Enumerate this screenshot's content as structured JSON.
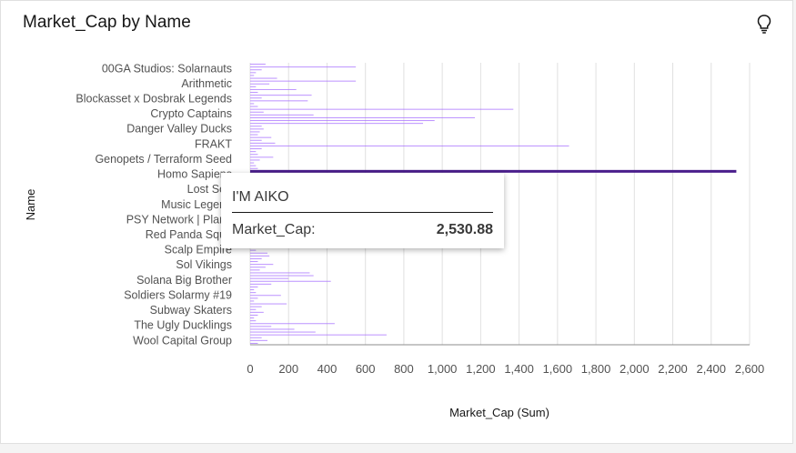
{
  "card": {
    "title": "Market_Cap by Name",
    "insight_icon": "lightbulb-icon"
  },
  "tooltip": {
    "name": "I'M AIKO",
    "label": "Market_Cap:",
    "value": "2,530.88"
  },
  "colors": {
    "bar": "#a56eff",
    "highlight": "#491d8b",
    "grid": "#e0e0e0"
  },
  "chart_data": {
    "type": "bar",
    "orientation": "horizontal",
    "title": "Market_Cap by Name",
    "xlabel": "Market_Cap (Sum)",
    "ylabel": "Name",
    "xlim": [
      0,
      2600
    ],
    "xticks": [
      0,
      200,
      400,
      600,
      800,
      1000,
      1200,
      1400,
      1600,
      1800,
      2000,
      2200,
      2400,
      2600
    ],
    "xtick_labels": [
      "0",
      "200",
      "400",
      "600",
      "800",
      "1,000",
      "1,200",
      "1,400",
      "1,600",
      "1,800",
      "2,000",
      "2,200",
      "2,400",
      "2,600"
    ],
    "labeled_categories": [
      "00GA Studios: Solarnauts",
      "Arithmetic",
      "Blockasset x Dosbrak Legends",
      "Crypto Captains",
      "Danger Valley Ducks",
      "FRAKT",
      "Genopets / Terraform Seed",
      "Homo Sapiens",
      "Lost Sou",
      "Music Legend",
      "PSY Network | Plane",
      "Red Panda Squa",
      "Scalp Empire",
      "Sol Vikings",
      "Solana Big Brother",
      "Soldiers Solarmy #19",
      "Subway Skaters",
      "The Ugly Ducklings",
      "Wool Capital Group"
    ],
    "highlighted": {
      "name": "I'M AIKO",
      "value": 2530.88
    },
    "values": [
      80,
      550,
      60,
      30,
      20,
      140,
      550,
      100,
      30,
      240,
      40,
      320,
      60,
      300,
      20,
      40,
      1370,
      70,
      330,
      1170,
      960,
      900,
      60,
      70,
      50,
      40,
      110,
      60,
      130,
      1660,
      60,
      30,
      40,
      120,
      50,
      20,
      30,
      40,
      2530.88,
      20,
      30,
      50,
      60,
      40,
      30,
      20,
      40,
      30,
      20,
      50,
      40,
      30,
      20,
      40,
      30,
      20,
      30,
      40,
      20,
      30,
      40,
      30,
      20,
      40,
      30,
      20,
      30,
      90,
      100,
      60,
      40,
      120,
      80,
      50,
      310,
      330,
      200,
      420,
      110,
      40,
      20,
      30,
      160,
      40,
      20,
      190,
      60,
      30,
      70,
      40,
      20,
      30,
      440,
      110,
      230,
      340,
      710,
      60,
      90,
      40
    ]
  }
}
